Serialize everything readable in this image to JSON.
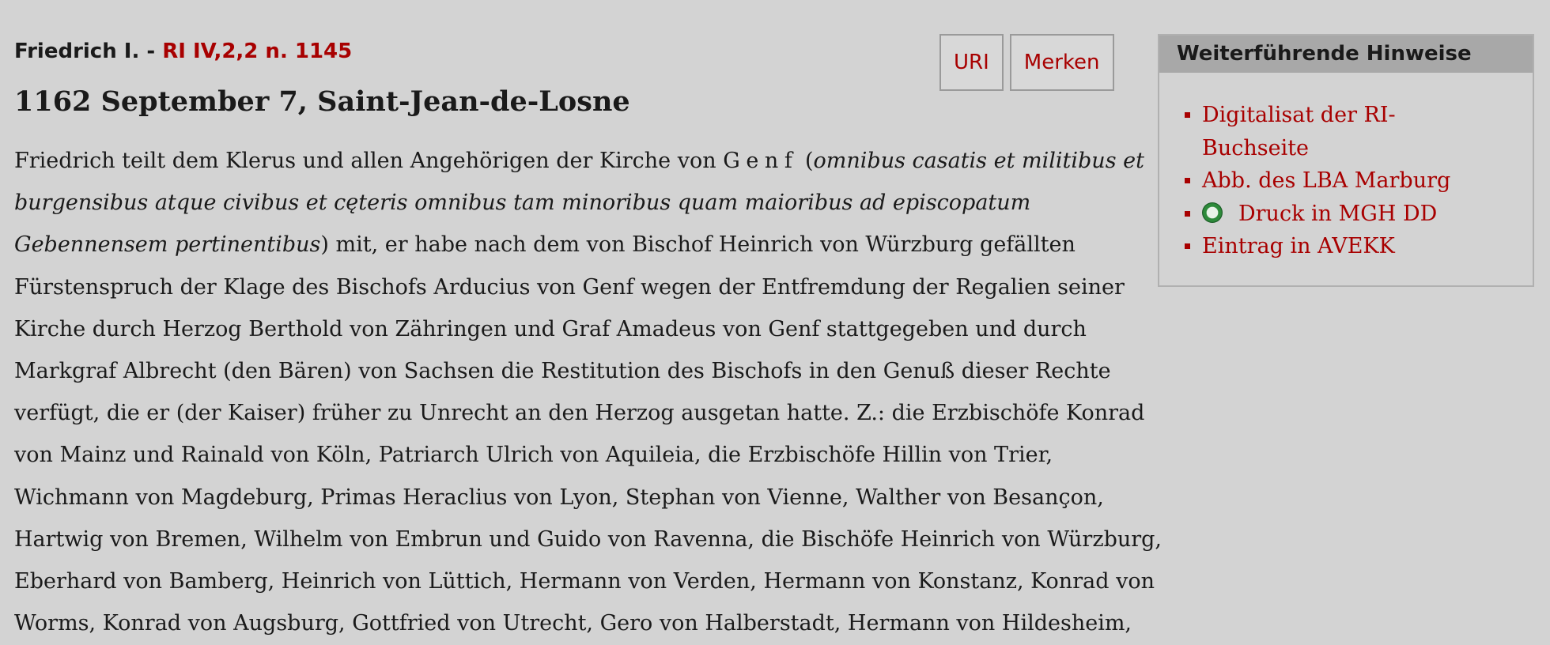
{
  "header": {
    "ruler": "Friedrich I.",
    "separator": " - ",
    "reference": "RI IV,2,2 n. 1145"
  },
  "date_place": "1162 September 7, Saint-Jean-de-Losne",
  "buttons": {
    "uri": "URI",
    "merken": "Merken"
  },
  "body": {
    "line1_a": "Friedrich teilt dem Klerus und allen Angehörigen der Kirche von ",
    "line1_spaced": "Genf",
    "line1_b": " (",
    "line1_italic": "omnibus casatis et militibus et",
    "line2_italic": "burgensibus atque civibus et cęteris omnibus tam minoribus quam maioribus ad episcopatum",
    "line3_italic": "Gebennensem pertinentibus",
    "line3_b": ") mit, er habe nach dem von Bischof Heinrich von Würzburg gefällten",
    "lines": [
      "Fürstenspruch der Klage des Bischofs Arducius von Genf wegen der Entfremdung der Regalien seiner",
      "Kirche durch Herzog Berthold von Zähringen und Graf Amadeus von Genf stattgegeben und durch",
      "Markgraf Albrecht (den Bären) von Sachsen die Restitution des Bischofs in den Genuß dieser Rechte",
      "verfügt, die er (der Kaiser) früher zu Unrecht an den Herzog ausgetan hatte. Z.: die Erzbischöfe Konrad",
      "von Mainz und Rainald von Köln, Patriarch Ulrich von Aquileia, die Erzbischöfe Hillin von Trier,",
      "Wichmann von Magdeburg, Primas Heraclius von Lyon, Stephan von Vienne, Walther von Besançon,",
      "Hartwig von Bremen, Wilhelm von Embrun und Guido von Ravenna, die Bischöfe Heinrich von Würzburg,",
      "Eberhard von Bamberg, Heinrich von Lüttich, Hermann von Verden, Hermann von Konstanz, Konrad von",
      "Worms, Konrad von Augsburg, Gottfried von Utrecht, Gero von Halberstadt, Hermann von Hildesheim,"
    ]
  },
  "sidebar": {
    "title": "Weiterführende Hinweise",
    "links": [
      {
        "label": "Digitalisat der RI-Buchseite",
        "line1": "Digitalisat der RI-",
        "line2": "Buchseite"
      },
      {
        "label": "Abb. des LBA Marburg"
      },
      {
        "label": "Druck in MGH DD",
        "icon": "mgh-circle-icon"
      },
      {
        "label": "Eintrag in AVEKK"
      }
    ]
  },
  "colors": {
    "background": "#d3d3d3",
    "link": "#a80000",
    "sidebar_header": "#a8a8a8"
  }
}
